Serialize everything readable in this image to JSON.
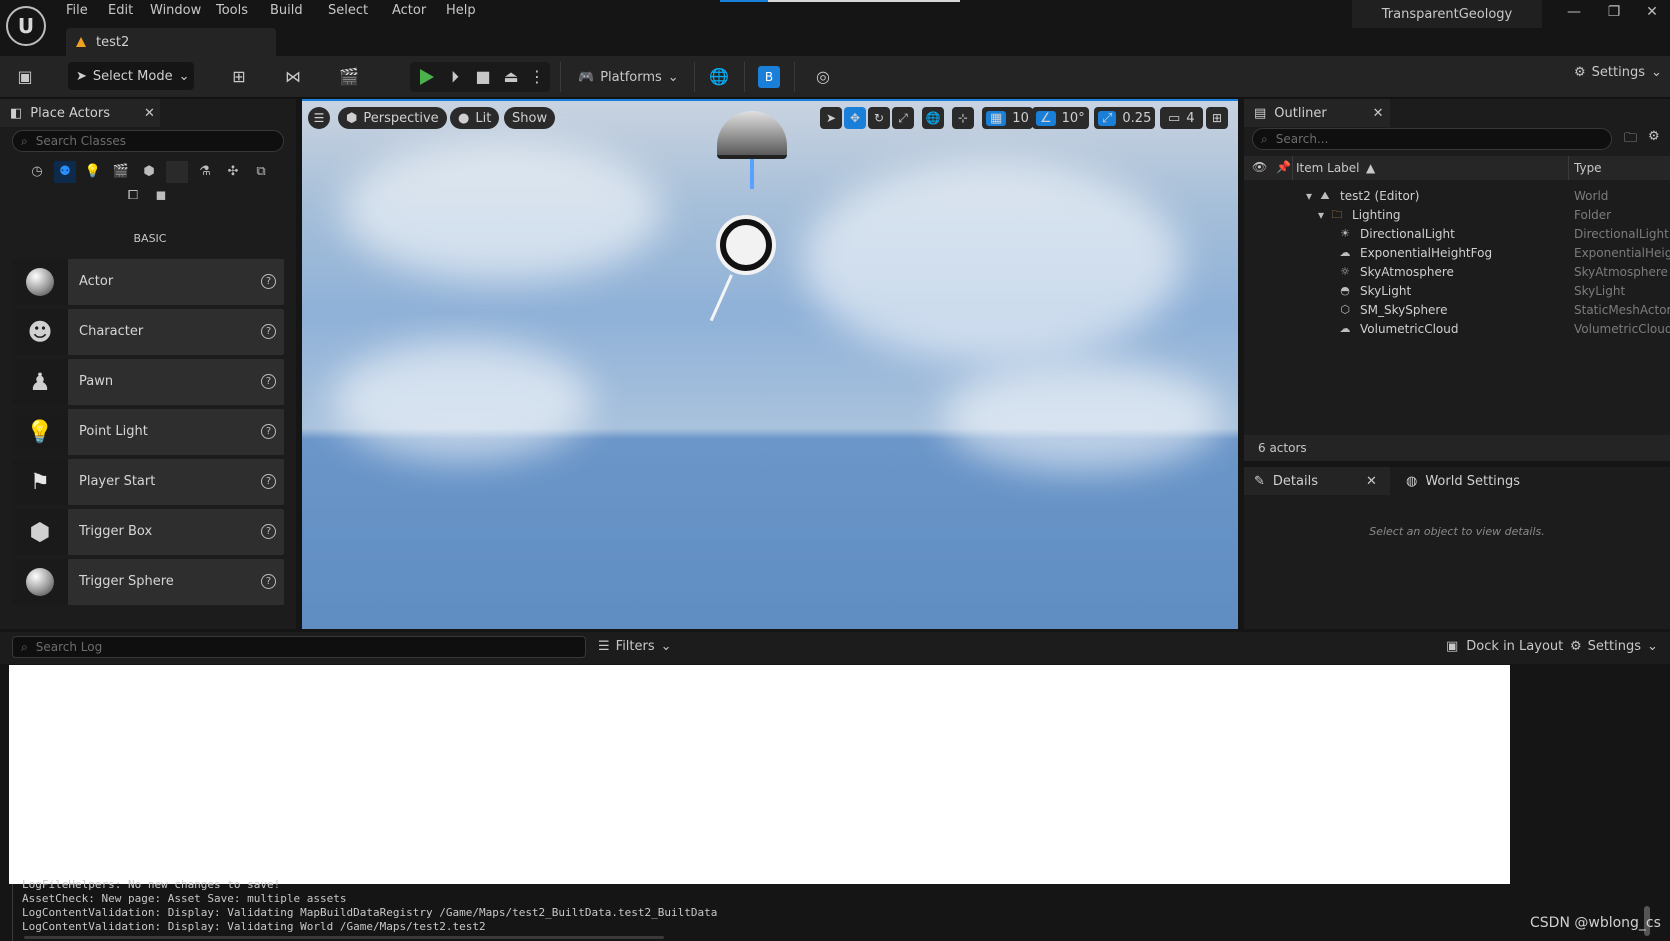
{
  "menu": [
    "File",
    "Edit",
    "Window",
    "Tools",
    "Build",
    "Select",
    "Actor",
    "Help"
  ],
  "project_name": "TransparentGeology",
  "document_tab": "test2",
  "toolbar": {
    "select_mode": "Select Mode",
    "platforms": "Platforms",
    "settings": "Settings"
  },
  "place_actors": {
    "title": "Place Actors",
    "search_placeholder": "Search Classes",
    "category_label": "BASIC",
    "actors": [
      {
        "name": "Actor",
        "icon": "sphere"
      },
      {
        "name": "Character",
        "icon": "character"
      },
      {
        "name": "Pawn",
        "icon": "pawn"
      },
      {
        "name": "Point Light",
        "icon": "light-bulb"
      },
      {
        "name": "Player Start",
        "icon": "flag"
      },
      {
        "name": "Trigger Box",
        "icon": "box"
      },
      {
        "name": "Trigger Sphere",
        "icon": "sphere"
      }
    ]
  },
  "viewport": {
    "perspective": "Perspective",
    "lit": "Lit",
    "show": "Show",
    "grid_snap": "10",
    "rotation_snap": "10°",
    "scale_snap": "0.25",
    "camera_speed": "4"
  },
  "outliner": {
    "title": "Outliner",
    "search_placeholder": "Search...",
    "col_label": "Item Label",
    "col_type": "Type",
    "items": [
      {
        "label": "test2 (Editor)",
        "type": "World",
        "depth": 0,
        "icon": "world"
      },
      {
        "label": "Lighting",
        "type": "Folder",
        "depth": 1,
        "icon": "folder"
      },
      {
        "label": "DirectionalLight",
        "type": "DirectionalLight",
        "depth": 2,
        "icon": "sun"
      },
      {
        "label": "ExponentialHeightFog",
        "type": "ExponentialHeigh",
        "depth": 2,
        "icon": "fog"
      },
      {
        "label": "SkyAtmosphere",
        "type": "SkyAtmosphere",
        "depth": 2,
        "icon": "atmosphere"
      },
      {
        "label": "SkyLight",
        "type": "SkyLight",
        "depth": 2,
        "icon": "skylight"
      },
      {
        "label": "SM_SkySphere",
        "type": "StaticMeshActor",
        "depth": 2,
        "icon": "mesh"
      },
      {
        "label": "VolumetricCloud",
        "type": "VolumetricCloud",
        "depth": 2,
        "icon": "cloud"
      }
    ],
    "footer": "6 actors"
  },
  "details": {
    "tab_details": "Details",
    "tab_world_settings": "World Settings",
    "empty_message": "Select an object to view details."
  },
  "log": {
    "search_placeholder": "Search Log",
    "filters": "Filters",
    "dock_in_layout": "Dock in Layout",
    "settings": "Settings",
    "lines": [
      "LogFileHelpers: No new changes to save!",
      "AssetCheck: New page: Asset Save: multiple assets",
      "LogContentValidation: Display: Validating MapBuildDataRegistry /Game/Maps/test2_BuiltData.test2_BuiltData",
      "LogContentValidation: Display: Validating World /Game/Maps/test2.test2"
    ]
  },
  "watermark": "CSDN @wblong_cs"
}
